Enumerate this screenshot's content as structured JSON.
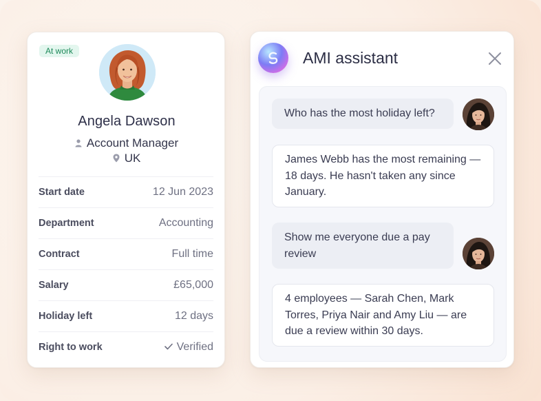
{
  "profile": {
    "status_badge": "At work",
    "name": "Angela Dawson",
    "role": "Account Manager",
    "location": "UK",
    "details": [
      {
        "label": "Start date",
        "value": "12 Jun 2023"
      },
      {
        "label": "Department",
        "value": "Accounting"
      },
      {
        "label": "Contract",
        "value": "Full time"
      },
      {
        "label": "Salary",
        "value": "£65,000"
      },
      {
        "label": "Holiday left",
        "value": "12 days"
      },
      {
        "label": "Right to work",
        "value": "Verified"
      }
    ]
  },
  "assistant": {
    "title": "AMI assistant",
    "messages": [
      {
        "from": "user",
        "text": "Who has the most holiday left?"
      },
      {
        "from": "bot",
        "text": "James Webb has the most remaining — 18 days. He hasn't taken any since January."
      },
      {
        "from": "user",
        "text": "Show me everyone due a pay review"
      },
      {
        "from": "bot",
        "text": "4 employees — Sarah Chen, Mark Torres, Priya Nair and Amy Liu — are due a review within 30 days."
      }
    ]
  },
  "colors": {
    "badge_bg": "#e3f6ee",
    "badge_text": "#1e8a5a",
    "accent_gradient": [
      "#b8e8ff",
      "#7d7cf5",
      "#c86ee8",
      "#ff8fd0"
    ]
  },
  "icons": {
    "role": "person-icon",
    "location": "map-pin-icon",
    "verified": "check-icon",
    "close": "close-icon",
    "logo": "ami-swirl-icon"
  }
}
